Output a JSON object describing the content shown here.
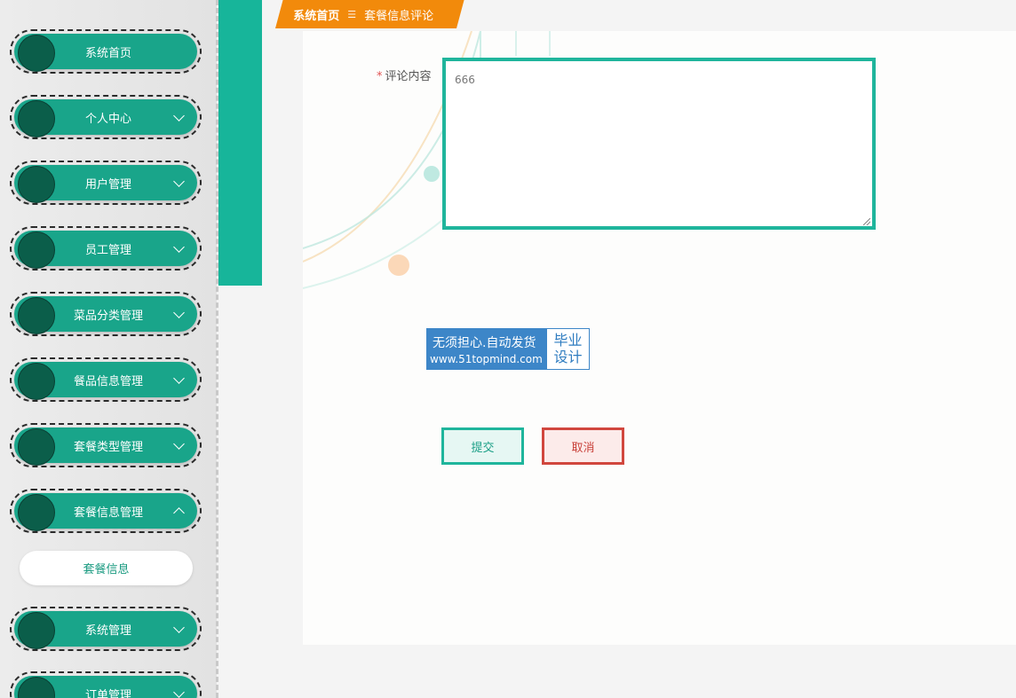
{
  "sidebar": {
    "items": [
      {
        "label": "系统首页",
        "chevron": "none"
      },
      {
        "label": "个人中心",
        "chevron": "down"
      },
      {
        "label": "用户管理",
        "chevron": "down"
      },
      {
        "label": "员工管理",
        "chevron": "down"
      },
      {
        "label": "菜品分类管理",
        "chevron": "down"
      },
      {
        "label": "餐品信息管理",
        "chevron": "down"
      },
      {
        "label": "套餐类型管理",
        "chevron": "down"
      },
      {
        "label": "套餐信息管理",
        "chevron": "up"
      },
      {
        "label": "系统管理",
        "chevron": "down"
      },
      {
        "label": "订单管理",
        "chevron": "down"
      }
    ],
    "active_sub_item": "套餐信息"
  },
  "breadcrumb": {
    "home": "系统首页",
    "separator": "☰",
    "current": "套餐信息评论"
  },
  "form": {
    "required_mark": "*",
    "content_label": "评论内容",
    "content_value": "666"
  },
  "watermark": {
    "line1": "无须担心.自动发货",
    "line2": "www.51topmind.com",
    "right_top": "毕业",
    "right_bottom": "设计"
  },
  "buttons": {
    "submit": "提交",
    "cancel": "取消"
  },
  "colors": {
    "accent_teal": "#19a58a",
    "dark_green": "#0b5e4a",
    "breadcrumb_orange": "#f28a0b",
    "cancel_red": "#d1473e"
  }
}
